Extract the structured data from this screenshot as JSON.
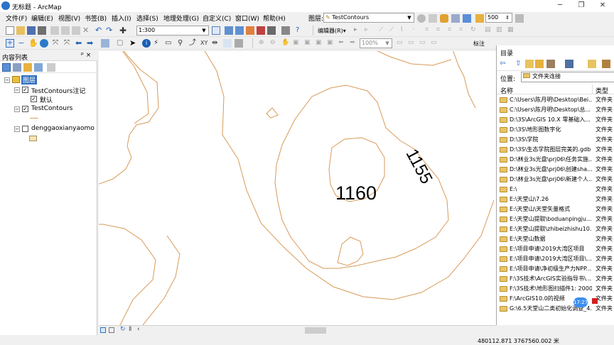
{
  "window": {
    "title": "无标题 - ArcMap",
    "min": "─",
    "max": "❐",
    "close": "✕"
  },
  "menu": [
    "文件(F)",
    "编辑(E)",
    "视图(V)",
    "书签(B)",
    "插入(I)",
    "选择(S)",
    "地理处理(G)",
    "自定义(C)",
    "窗口(W)",
    "帮助(H)"
  ],
  "layer_combo": {
    "label": "图层:",
    "value": "TestContours"
  },
  "scale": "1:300",
  "editor_label": "编辑器(R)▾",
  "number_input": "500",
  "zoom": "100%",
  "label_tool": "标注",
  "toc": {
    "title": "内容列表",
    "pin": "ᵖ ×",
    "root": "图层",
    "layers": [
      {
        "name": "TestContours注记",
        "checked": true,
        "sub": "默认"
      },
      {
        "name": "TestContours",
        "checked": true
      },
      {
        "name": "denggaoxianyaomo",
        "checked": false
      }
    ]
  },
  "map": {
    "labels": [
      "1160",
      "1155"
    ]
  },
  "catalog": {
    "title": "目录",
    "location_label": "位置:",
    "location_value": "文件夹连接",
    "col_name": "名称",
    "col_type": "类型",
    "rows": [
      {
        "name": "C:\\Users\\陈月明\\Desktop\\Bei...",
        "type": "文件夹"
      },
      {
        "name": "C:\\Users\\陈月明\\Desktop\\总...",
        "type": "文件夹"
      },
      {
        "name": "D:\\3S\\ArcGIS 10.X 零基础入...",
        "type": "文件夹"
      },
      {
        "name": "D:\\3S\\地形图数字化",
        "type": "文件夹"
      },
      {
        "name": "D:\\3S\\学院",
        "type": "文件夹"
      },
      {
        "name": "D:\\3S\\生态学院图层完美的.gdb",
        "type": "文件夹"
      },
      {
        "name": "D:\\林业3s光盘\\prj06\\任务实施...",
        "type": "文件夹"
      },
      {
        "name": "D:\\林业3s光盘\\prj06\\创建sha...",
        "type": "文件夹"
      },
      {
        "name": "D:\\林业3s光盘\\prj06\\新建个人...",
        "type": "文件夹"
      },
      {
        "name": "E:\\",
        "type": "文件夹"
      },
      {
        "name": "E:\\天堂山\\7.26",
        "type": "文件夹"
      },
      {
        "name": "E:\\天堂山\\天堂矢量格式",
        "type": "文件夹"
      },
      {
        "name": "E:\\天堂山提取\\boduanpingju...",
        "type": "文件夹"
      },
      {
        "name": "E:\\天堂山提取\\zhibeizhishu10...",
        "type": "文件夹"
      },
      {
        "name": "E:\\天堂山数据",
        "type": "文件夹"
      },
      {
        "name": "E:\\项目申请\\2019大湾区项目",
        "type": "文件夹"
      },
      {
        "name": "E:\\项目申请\\2019大湾区项目\\...",
        "type": "文件夹"
      },
      {
        "name": "E:\\项目申请\\净初级生产力NPP...",
        "type": "文件夹"
      },
      {
        "name": "F:\\3S技术\\ArcGIS实验指导书\\...",
        "type": "文件夹"
      },
      {
        "name": "F:\\3S技术\\地形图扫描件1: 2000",
        "type": "文件夹"
      },
      {
        "name": "F:\\ArcGIS10.0的视频",
        "type": "文件夹"
      },
      {
        "name": "G:\\6.5天堂山二类初始化调查_4...",
        "type": "文件夹"
      }
    ],
    "timer": "17:27"
  },
  "status": {
    "coords": "480112.871  3767560.002 米"
  }
}
